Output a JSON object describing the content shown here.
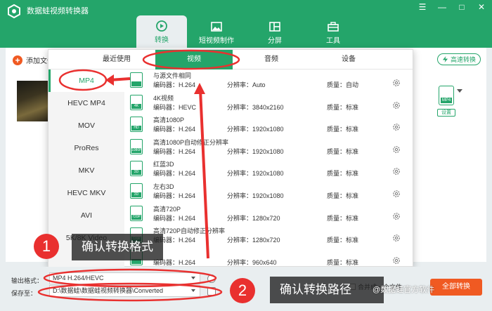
{
  "app": {
    "title": "数据蛙视频转换器"
  },
  "window_controls": [
    "☰",
    "—",
    "□",
    "✕"
  ],
  "nav": {
    "tabs": [
      {
        "label": "转换",
        "icon": "convert-icon",
        "active": true
      },
      {
        "label": "短视频制作",
        "icon": "image-icon",
        "active": false
      },
      {
        "label": "分屏",
        "icon": "split-screen-icon",
        "active": false
      },
      {
        "label": "工具",
        "icon": "toolbox-icon",
        "active": false
      }
    ]
  },
  "main": {
    "add_file_label": "添加文件",
    "speed_button_label": "高速转换",
    "format_icon_label": "MP4",
    "settings_label": "设置"
  },
  "panel": {
    "tabs": [
      "最近使用",
      "视频",
      "音频",
      "设备"
    ],
    "active_tab": "视频",
    "formats": [
      "MP4",
      "HEVC MP4",
      "MOV",
      "ProRes",
      "MKV",
      "HEVC MKV",
      "AVI",
      "5K/8K Video"
    ],
    "active_format": "MP4",
    "presets": [
      {
        "name": "与源文件相同",
        "codec": "编码器：H.264",
        "res": "分辨率：Auto",
        "quality": "质量：自动",
        "icon_label": ""
      },
      {
        "name": "4K视频",
        "codec": "编码器：HEVC",
        "res": "分辨率：3840x2160",
        "quality": "质量：标准",
        "icon_label": "4K"
      },
      {
        "name": "高清1080P",
        "codec": "编码器：H.264",
        "res": "分辨率：1920x1080",
        "quality": "质量：标准",
        "icon_label": "HD"
      },
      {
        "name": "高清1080P自动修正分辨率",
        "codec": "编码器：H.264",
        "res": "分辨率：1920x1080",
        "quality": "质量：标准",
        "icon_label": "1080P"
      },
      {
        "name": "红蓝3D",
        "codec": "编码器：H.264",
        "res": "分辨率：1920x1080",
        "quality": "质量：标准",
        "icon_label": "3D"
      },
      {
        "name": "左右3D",
        "codec": "编码器：H.264",
        "res": "分辨率：1920x1080",
        "quality": "质量：标准",
        "icon_label": "3D"
      },
      {
        "name": "高清720P",
        "codec": "编码器：H.264",
        "res": "分辨率：1280x720",
        "quality": "质量：标准",
        "icon_label": "720P"
      },
      {
        "name": "高清720P自动修正分辨率",
        "codec": "编码器：H.264",
        "res": "分辨率：1280x720",
        "quality": "质量：标准",
        "icon_label": "720P"
      },
      {
        "name": "",
        "codec": "编码器：H.264",
        "res": "分辨率：960x640",
        "quality": "质量：标准",
        "icon_label": ""
      }
    ]
  },
  "bottom": {
    "output_label": "输出格式：",
    "output_value": "MP4 H.264/HEVC",
    "save_label": "保存至：",
    "save_value": "D:\\数据蛙\\数据蛙视频转换器\\Converted",
    "merge_label": "合并成一个文件",
    "convert_all_label": "全部转换"
  },
  "annotations": {
    "step1_number": "1",
    "step1_text": "确认转换格式",
    "step2_number": "2",
    "step2_text": "确认转换路径",
    "watermark": "@数据蛙官方软件",
    "accent_color": "#24a56a",
    "annotation_color": "#e9302f"
  }
}
